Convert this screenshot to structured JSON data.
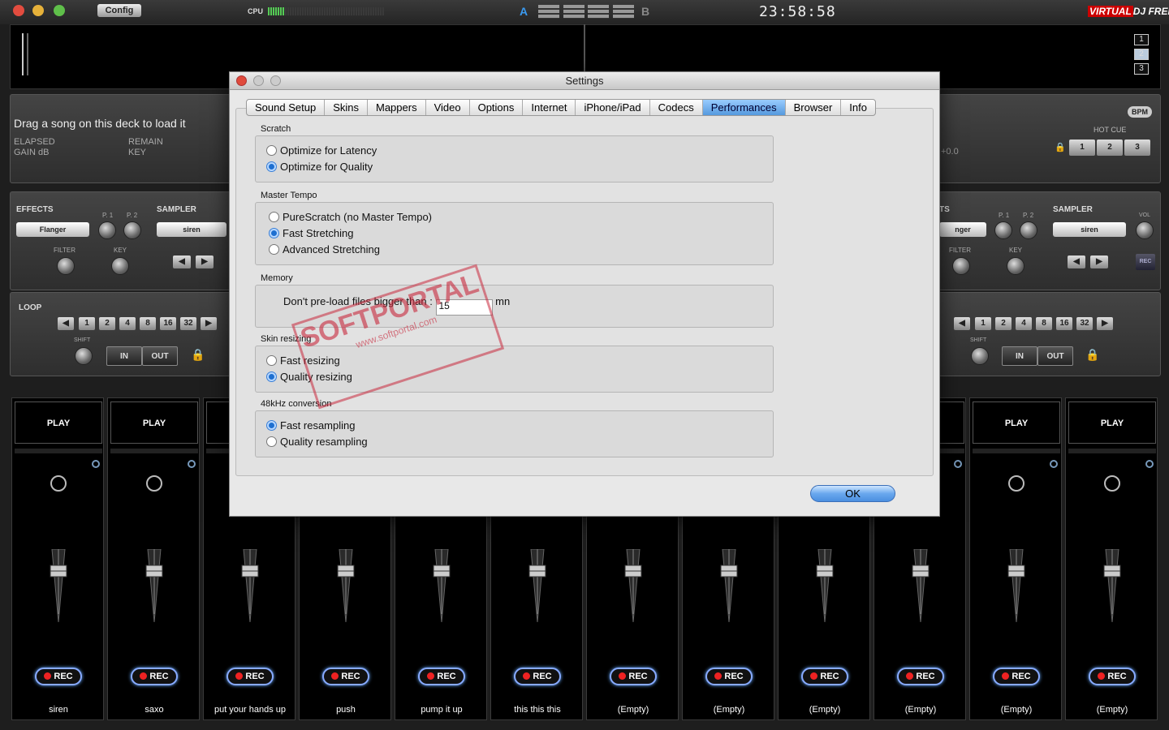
{
  "topbar": {
    "config": "Config",
    "cpu": "CPU",
    "deck_a": "A",
    "deck_b": "B",
    "clock": "23:58:58",
    "logo_virtual": "VIRTUAL",
    "logo_dj": "DJ",
    "logo_free": "FREE"
  },
  "cpu_level": 0.15,
  "colors": {
    "accent": "#3a9af0",
    "rec_glow": "#66aaff",
    "rec_dot": "#e22222"
  },
  "views": [
    "1",
    "2",
    "3"
  ],
  "deck_left": {
    "drag_text": "Drag a song on this deck to load it",
    "elapsed": "ELAPSED",
    "remain": "REMAIN",
    "gain": "GAIN dB",
    "key": "KEY",
    "effects": "EFFECTS",
    "effect_select": "Flanger",
    "p1": "P. 1",
    "p2": "P. 2",
    "filter": "FILTER",
    "key_knob": "KEY",
    "sampler": "SAMPLER",
    "sampler_select": "siren",
    "loop": "LOOP",
    "loop_sizes": [
      "1",
      "2",
      "4",
      "8",
      "16",
      "32"
    ],
    "shift": "SHIFT",
    "in": "IN",
    "out": "OUT"
  },
  "deck_right": {
    "bpm": "BPM",
    "hot_cue": "HOT CUE",
    "hot_cues": [
      "1",
      "2",
      "3"
    ],
    "pitch": "+0.0",
    "effect_partial": "TS",
    "effect_select_partial": "nger",
    "p1": "P. 1",
    "p2": "P. 2",
    "filter": "FILTER",
    "key_knob": "KEY",
    "sampler": "SAMPLER",
    "sampler_select": "siren",
    "vol": "VOL",
    "rec": "REC",
    "loop_sizes": [
      "1",
      "2",
      "4",
      "8",
      "16",
      "32"
    ],
    "shift": "SHIFT",
    "in": "IN",
    "out": "OUT"
  },
  "sampler": {
    "play": "PLAY",
    "rec": "REC",
    "slots": [
      "siren",
      "saxo",
      "put your hands up",
      "push",
      "pump it up",
      "this this this",
      "(Empty)",
      "(Empty)",
      "(Empty)",
      "(Empty)",
      "(Empty)",
      "(Empty)"
    ]
  },
  "dialog": {
    "title": "Settings",
    "tabs": [
      "Sound Setup",
      "Skins",
      "Mappers",
      "Video",
      "Options",
      "Internet",
      "iPhone/iPad",
      "Codecs",
      "Performances",
      "Browser",
      "Info"
    ],
    "active_tab": "Performances",
    "scratch": {
      "title": "Scratch",
      "opt1": "Optimize for Latency",
      "opt2": "Optimize for Quality",
      "selected": "Optimize for Quality"
    },
    "master_tempo": {
      "title": "Master Tempo",
      "opt1": "PureScratch (no Master Tempo)",
      "opt2": "Fast Stretching",
      "opt3": "Advanced Stretching",
      "selected": "Fast Stretching"
    },
    "memory": {
      "title": "Memory",
      "label": "Don't pre-load files bigger than :",
      "value": "15",
      "unit": "mn"
    },
    "skin_resizing": {
      "title": "Skin resizing",
      "opt1": "Fast resizing",
      "opt2": "Quality resizing",
      "selected": "Quality resizing"
    },
    "conversion": {
      "title": "48kHz conversion",
      "opt1": "Fast resampling",
      "opt2": "Quality resampling",
      "selected": "Fast resampling"
    },
    "ok": "OK"
  },
  "watermark": {
    "brand": "SOFTPORTAL",
    "url": "www.softportal.com"
  }
}
